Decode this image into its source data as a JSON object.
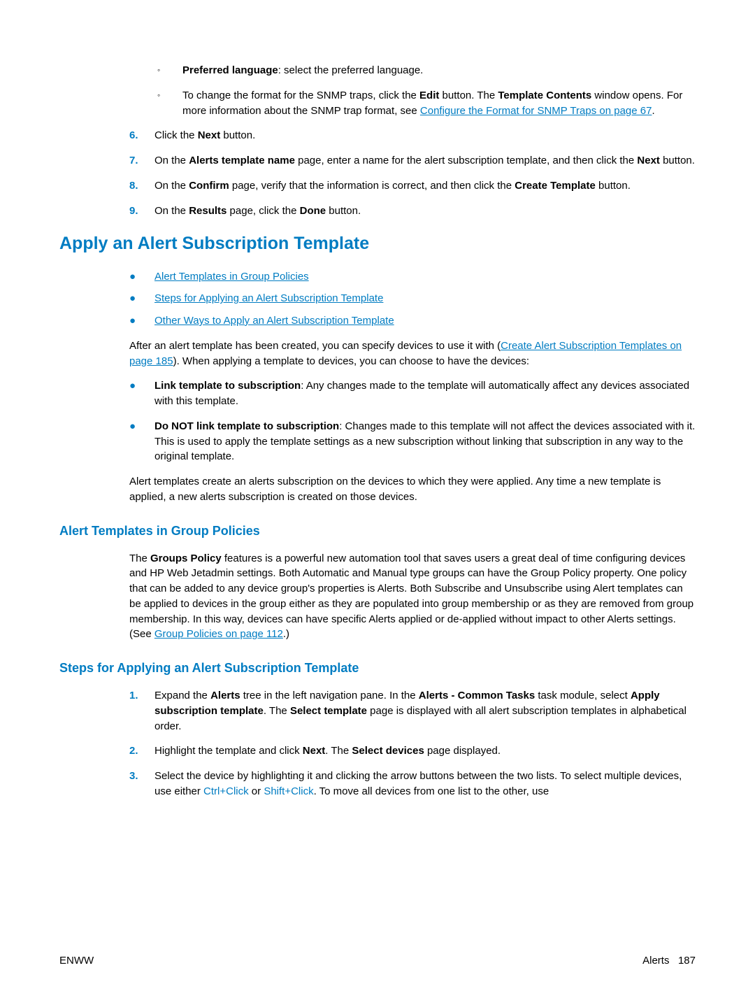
{
  "top_circ_items": [
    {
      "bold": "Preferred language",
      "rest": ": select the preferred language."
    },
    {
      "bold": "",
      "pre": "To change the format for the SNMP traps, click the ",
      "btn1": "Edit",
      "mid": " button. The ",
      "btn2": "Template Contents",
      "post": " window opens. For more information about the SNMP trap format, see ",
      "link": "Configure the Format for SNMP Traps on page 67",
      "tail": "."
    }
  ],
  "num6": {
    "n": "6.",
    "pre": "Click the ",
    "b": "Next",
    "post": " button."
  },
  "num7": {
    "n": "7.",
    "pre": "On the ",
    "b1": "Alerts template name",
    "mid": " page, enter a name for the alert subscription template, and then click the ",
    "b2": "Next",
    "post": " button."
  },
  "num8": {
    "n": "8.",
    "pre": "On the ",
    "b1": "Confirm",
    "mid": " page, verify that the information is correct, and then click the ",
    "b2": "Create Template",
    "post": " button."
  },
  "num9": {
    "n": "9.",
    "pre": "On the ",
    "b1": "Results",
    "mid": " page, click the ",
    "b2": "Done",
    "post": " button."
  },
  "section_title": "Apply an Alert Subscription Template",
  "link_list": [
    "Alert Templates in Group Policies",
    "Steps for Applying an Alert Subscription Template",
    "Other Ways to Apply an Alert Subscription Template"
  ],
  "para_after_links": {
    "pre": "After an alert template has been created, you can specify devices to use it with (",
    "link": "Create Alert Subscription Templates on page 185",
    "post": "). When applying a template to devices, you can choose to have the devices:"
  },
  "choice_bullets": [
    {
      "b": "Link template to subscription",
      "rest": ": Any changes made to the template will automatically affect any devices associated with this template."
    },
    {
      "b": "Do NOT link template to subscription",
      "rest": ": Changes made to this template will not affect the devices associated with it. This is used to apply the template settings as a new subscription without linking that subscription in any way to the original template."
    }
  ],
  "para_after_choices": "Alert templates create an alerts subscription on the devices to which they were applied. Any time a new template is applied, a new alerts subscription is created on those devices.",
  "sub1_title": "Alert Templates in Group Policies",
  "sub1_para": {
    "pre": "The ",
    "b": "Groups Policy",
    "mid": " features is a powerful new automation tool that saves users a great deal of time configuring devices and HP Web Jetadmin settings. Both Automatic and Manual type groups can have the Group Policy property. One policy that can be added to any device group's properties is Alerts. Both Subscribe and Unsubscribe using Alert templates can be applied to devices in the group either as they are populated into group membership or as they are removed from group membership. In this way, devices can have specific Alerts applied or de-applied without impact to other Alerts settings. (See ",
    "link": "Group Policies on page 112",
    "post": ".)"
  },
  "sub2_title": "Steps for Applying an Alert Subscription Template",
  "step1": {
    "n": "1.",
    "pre": "Expand the ",
    "b1": "Alerts",
    "mid1": " tree in the left navigation pane. In the ",
    "b2": "Alerts - Common Tasks",
    "mid2": " task module, select ",
    "b3": "Apply subscription template",
    "mid3": ". The ",
    "b4": "Select template",
    "post": " page is displayed with all alert subscription templates in alphabetical order."
  },
  "step2": {
    "n": "2.",
    "pre": "Highlight the template and click ",
    "b1": "Next",
    "mid": ". The ",
    "b2": "Select devices",
    "post": " page displayed."
  },
  "step3": {
    "n": "3.",
    "pre": "Select the device by highlighting it and clicking the arrow buttons between the two lists. To select multiple devices, use either ",
    "k1": "Ctrl+Click",
    "mid": " or ",
    "k2": "Shift+Click",
    "post": ". To move all devices from one list to the other, use"
  },
  "footer_left": "ENWW",
  "footer_right_label": "Alerts",
  "footer_right_page": "187"
}
